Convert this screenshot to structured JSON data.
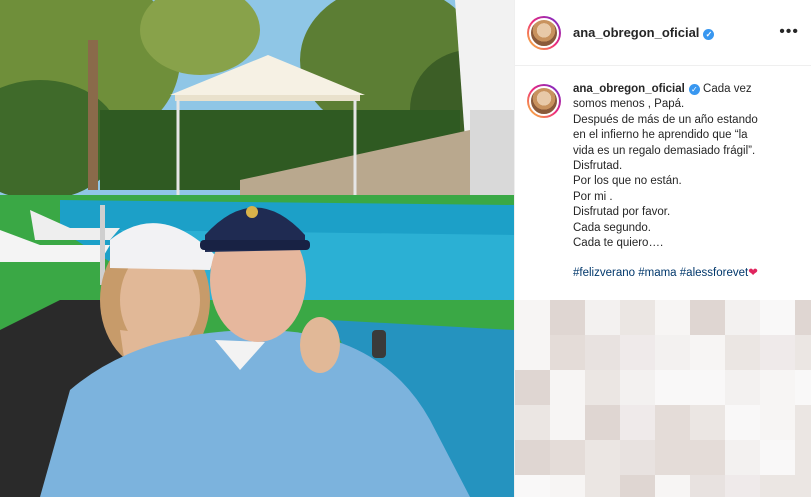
{
  "post": {
    "author": {
      "username": "ana_obregon_oficial",
      "verified": true
    },
    "more_options_icon": "ellipsis-icon",
    "caption": {
      "first_line": "Cada vez",
      "lines": [
        "somos menos , Papá.",
        "Después de más de un año estando",
        "en el infierno he aprendido que “la",
        "vida es un regalo demasiado frágil”.",
        "Disfrutad.",
        "Por los que no están.",
        "Por mi .",
        "Disfrutad por favor.",
        "Cada segundo.",
        "Cada te quiero…."
      ],
      "hashtags": [
        "#felizverano",
        "#mama",
        "#alessforevet"
      ],
      "emoji": "❤"
    }
  },
  "colors": {
    "link": "#00376b",
    "verified": "#3897f0",
    "heart": "#e0245e"
  }
}
